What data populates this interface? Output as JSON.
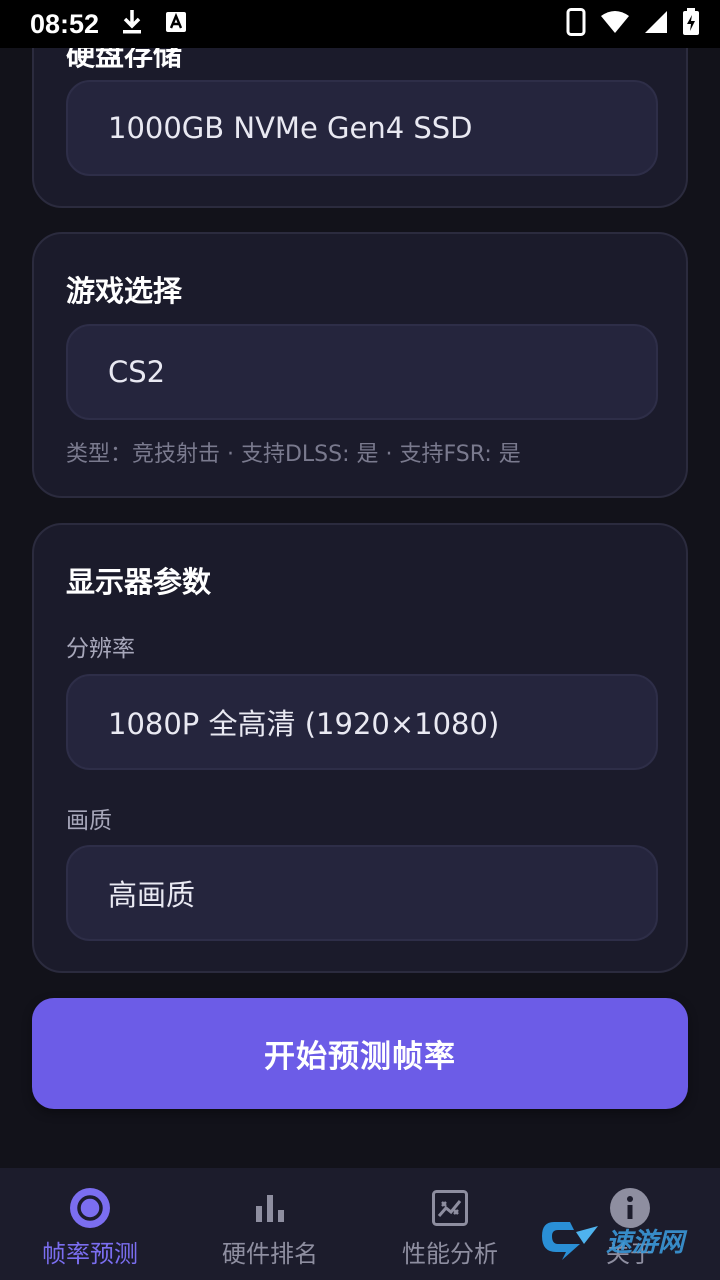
{
  "status_bar": {
    "time": "08:52",
    "icons": [
      "download-icon",
      "a-badge-icon",
      "phone-icon",
      "wifi-icon",
      "signal-icon",
      "battery-charging-icon"
    ]
  },
  "storage_card": {
    "title": "硬盘存储",
    "value": "1000GB NVMe Gen4 SSD"
  },
  "game_card": {
    "title": "游戏选择",
    "value": "CS2",
    "hint": "类型：竞技射击 · 支持DLSS: 是 · 支持FSR: 是"
  },
  "display_card": {
    "title": "显示器参数",
    "resolution_label": "分辨率",
    "resolution_value": "1080P 全高清 (1920×1080)",
    "quality_label": "画质",
    "quality_value": "高画质"
  },
  "predict_button": "开始预测帧率",
  "bottom_nav": [
    {
      "label": "帧率预测",
      "icon": "circle-icon",
      "active": true
    },
    {
      "label": "硬件排名",
      "icon": "bar-chart-icon",
      "active": false
    },
    {
      "label": "性能分析",
      "icon": "line-chart-icon",
      "active": false
    },
    {
      "label": "关于",
      "icon": "info-icon",
      "active": false
    }
  ],
  "watermark": "速游网",
  "colors": {
    "accent": "#6c5ce7",
    "background": "#12121a",
    "card": "#1b1b2b",
    "field": "#25253d",
    "nav_active": "#7b6ef0",
    "nav_inactive": "#8e8ea0"
  }
}
